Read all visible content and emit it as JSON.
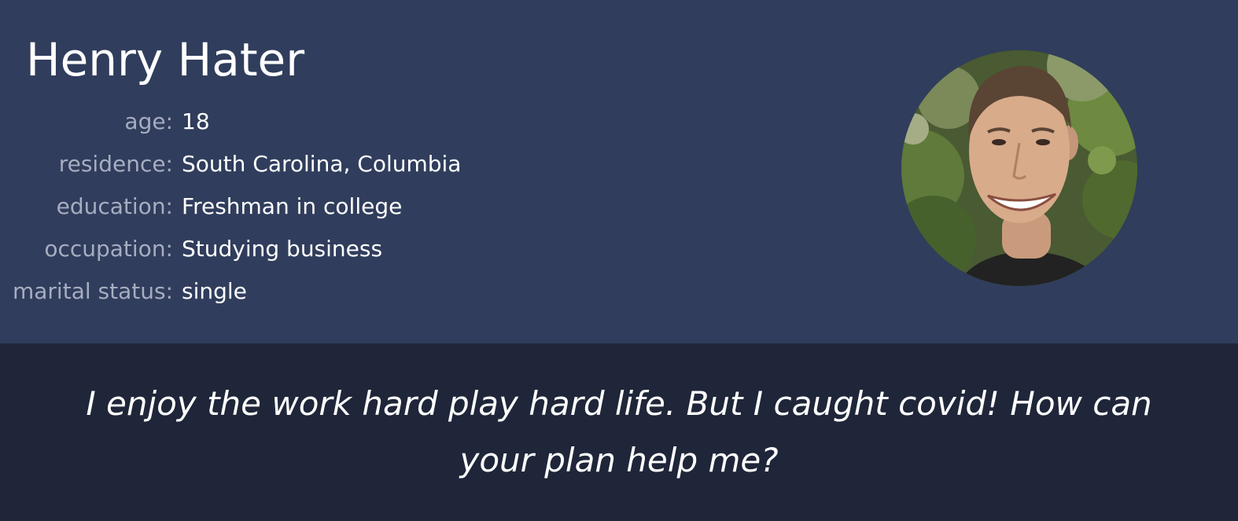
{
  "persona": {
    "name": "Henry Hater",
    "fields": [
      {
        "label": "age:",
        "value": "18"
      },
      {
        "label": "residence:",
        "value": "South Carolina, Columbia"
      },
      {
        "label": "education:",
        "value": "Freshman in college"
      },
      {
        "label": "occupation:",
        "value": "Studying business"
      },
      {
        "label": "marital status:",
        "value": "single"
      }
    ],
    "quote": "I enjoy the work hard play hard life. But I caught covid! How can your plan help me?"
  },
  "colors": {
    "profile_background": "#303d5c",
    "quote_background": "#1f2639",
    "label_text": "#a7adc0",
    "value_text": "#ffffff"
  }
}
